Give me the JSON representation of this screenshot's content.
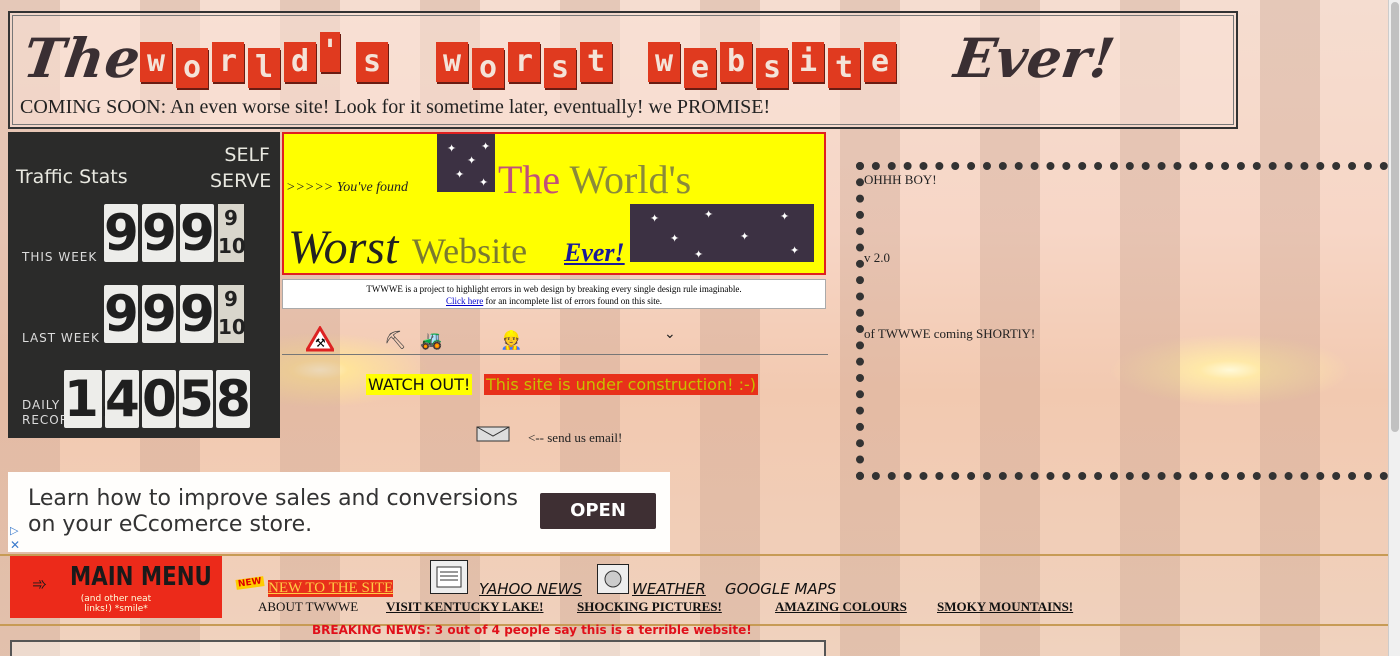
{
  "header": {
    "logo_the": "The",
    "logo_worlds": [
      "w",
      "o",
      "r",
      "l",
      "d",
      "'",
      "s"
    ],
    "logo_worst": [
      "w",
      "o",
      "r",
      "s",
      "t"
    ],
    "logo_website": [
      "w",
      "e",
      "b",
      "s",
      "i",
      "t",
      "e"
    ],
    "logo_ever": "Ever!",
    "coming_soon": "COMING SOON: An even worse site! Look for it sometime later, eventually!  we PROMISE!"
  },
  "stats": {
    "title": "Traffic Stats",
    "self_serve": "SELF SERVE",
    "this_week_label": "THIS WEEK",
    "this_week_digits": [
      "9",
      "9",
      "9"
    ],
    "this_week_frac": [
      "9",
      "10"
    ],
    "last_week_label": "LAST WEEK",
    "last_week_digits": [
      "9",
      "9",
      "9"
    ],
    "last_week_frac": [
      "9",
      "10"
    ],
    "daily_label": "DAILY RECORD",
    "daily_digits": [
      "1.",
      "4",
      "0",
      "5",
      "8"
    ]
  },
  "banner": {
    "prefix": ">>>>> You've found",
    "the": "The",
    "worlds": "World's",
    "worst": "Worst",
    "website": "Website",
    "ever": "Ever!"
  },
  "desc": {
    "line1": "TWWWE is a project to highlight errors in web design by breaking every single design rule imaginable.",
    "click_here": "Click here",
    "line2_rest": " for an incomplete list of errors found on this site."
  },
  "construction": {
    "watch_out": "WATCH OUT!",
    "under_construction": "This site is under construction! :-)",
    "email": "<-- send us email!"
  },
  "right_panel": {
    "oh_boy": "OHHH BOY!",
    "version": "v 2.0",
    "coming": "of TWWWE coming SHORTlY!"
  },
  "ad": {
    "text": "Learn how to improve sales and conversions on your eCcomerce store.",
    "button": "OPEN"
  },
  "menu": {
    "main_menu": "MAIN MENU",
    "sub": "(and other neat links!) *smile*",
    "new_badge": "NEW",
    "new_to_site": "NEW TO THE SITE",
    "yahoo": "YAHOO NEWS",
    "weather": "WEATHER",
    "google_maps": "GOOGLE MAPS",
    "about": "ABOUT TWWWE",
    "kentucky": "VISIT KENTUCKY LAKE!",
    "shocking": "SHOCKING PICTURES!",
    "colours": "AMAZING COLOURS",
    "smoky": "SMOKY MOUNTAINS!",
    "breaking": "BREAKING NEWS:  3 out of 4 people say this is a terrible website!"
  },
  "colors": {
    "tile_red": "#e03a1f",
    "banner_yellow": "#ffff00",
    "construction_red": "#e8301a"
  }
}
